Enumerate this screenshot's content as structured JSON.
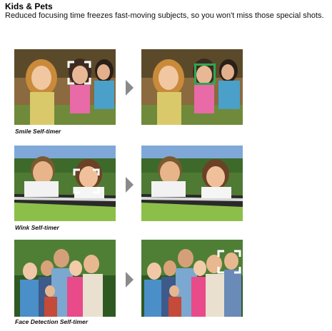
{
  "header": {
    "title": "Kids & Pets",
    "subtitle": "Reduced focusing time freezes fast-moving subjects, so you won't miss those special shots."
  },
  "rows": [
    {
      "caption": "Smile Self-timer"
    },
    {
      "caption": "Wink Self-timer"
    },
    {
      "caption": "Face Detection Self-timer"
    }
  ],
  "icons": {
    "arrow": "right-arrow-icon",
    "focus": "focus-bracket-icon",
    "focus_locked": "focus-box-icon"
  },
  "colors": {
    "arrow": "#8a8a8a",
    "focus_bracket": "#ffffff",
    "focus_locked": "#2fa84f"
  }
}
